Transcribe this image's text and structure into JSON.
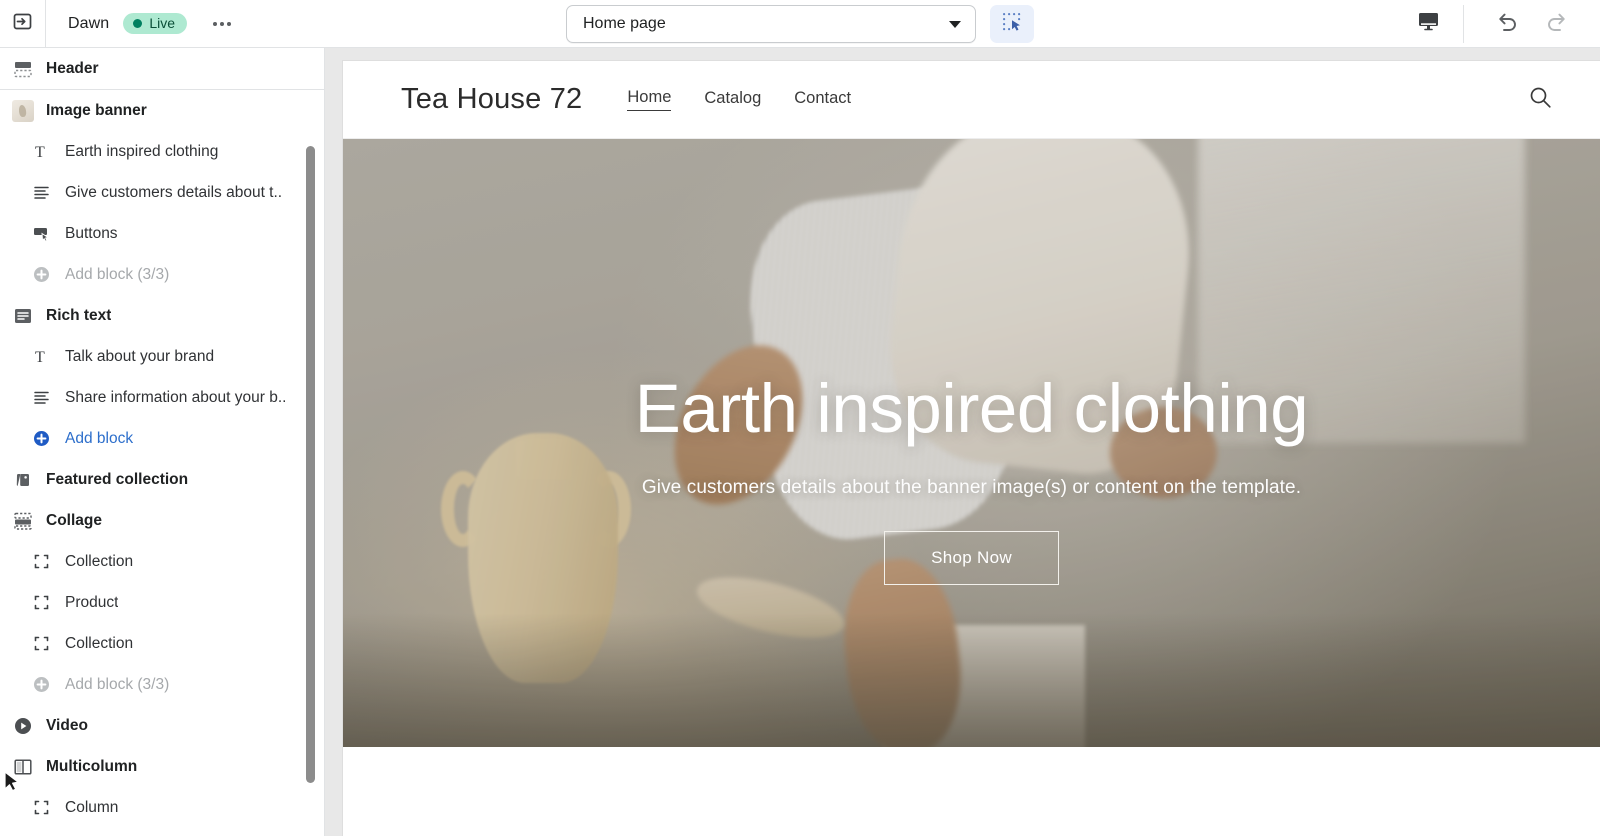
{
  "topbar": {
    "collapse_icon": "panel-collapse-icon",
    "theme_name": "Dawn",
    "status_label": "Live",
    "more_label": "",
    "page_selector_value": "Home page",
    "inspect_icon": "select-inspector-icon",
    "device_icon": "desktop-preview-icon",
    "undo_icon": "undo-icon",
    "redo_icon": "redo-icon"
  },
  "sidebar": {
    "groups": [
      {
        "section": {
          "label": "Header",
          "icon": "header-layout-icon"
        },
        "blocks": []
      },
      {
        "section": {
          "label": "Image banner",
          "icon": "image-thumbnail-icon"
        },
        "blocks": [
          {
            "label": "Earth inspired clothing",
            "icon": "text-heading-icon",
            "kind": "block"
          },
          {
            "label": "Give customers details about t..",
            "icon": "paragraph-icon",
            "kind": "block"
          },
          {
            "label": "Buttons",
            "icon": "button-icon",
            "kind": "block"
          },
          {
            "label": "Add block (3/3)",
            "icon": "plus-circle-icon",
            "kind": "add",
            "state": "disabled"
          }
        ]
      },
      {
        "section": {
          "label": "Rich text",
          "icon": "rich-text-icon"
        },
        "blocks": [
          {
            "label": "Talk about your brand",
            "icon": "text-heading-icon",
            "kind": "block"
          },
          {
            "label": "Share information about your b..",
            "icon": "paragraph-icon",
            "kind": "block"
          },
          {
            "label": "Add block",
            "icon": "plus-circle-icon",
            "kind": "add",
            "state": "active"
          }
        ]
      },
      {
        "section": {
          "label": "Featured collection",
          "icon": "tag-collection-icon"
        },
        "blocks": []
      },
      {
        "section": {
          "label": "Collage",
          "icon": "collage-icon"
        },
        "blocks": [
          {
            "label": "Collection",
            "icon": "block-bracket-icon",
            "kind": "block"
          },
          {
            "label": "Product",
            "icon": "block-bracket-icon",
            "kind": "block"
          },
          {
            "label": "Collection",
            "icon": "block-bracket-icon",
            "kind": "block"
          },
          {
            "label": "Add block (3/3)",
            "icon": "plus-circle-icon",
            "kind": "add",
            "state": "disabled"
          }
        ]
      },
      {
        "section": {
          "label": "Video",
          "icon": "play-circle-icon"
        },
        "blocks": []
      },
      {
        "section": {
          "label": "Multicolumn",
          "icon": "multicolumn-icon"
        },
        "blocks": [
          {
            "label": "Column",
            "icon": "block-bracket-icon",
            "kind": "block"
          }
        ]
      }
    ]
  },
  "preview": {
    "store": {
      "logo": "Tea House 72",
      "nav": [
        {
          "label": "Home",
          "active": true
        },
        {
          "label": "Catalog",
          "active": false
        },
        {
          "label": "Contact",
          "active": false
        }
      ],
      "search_icon": "search-icon"
    },
    "hero": {
      "title": "Earth inspired clothing",
      "subtitle": "Give customers details about the banner image(s) or content on the template.",
      "button_label": "Shop Now"
    }
  },
  "colors": {
    "accent_blue": "#2c6ecb",
    "live_badge_bg": "#aee9d1",
    "live_dot": "#008060",
    "border": "#e1e3e5",
    "preview_bg": "#e8e8e8"
  }
}
